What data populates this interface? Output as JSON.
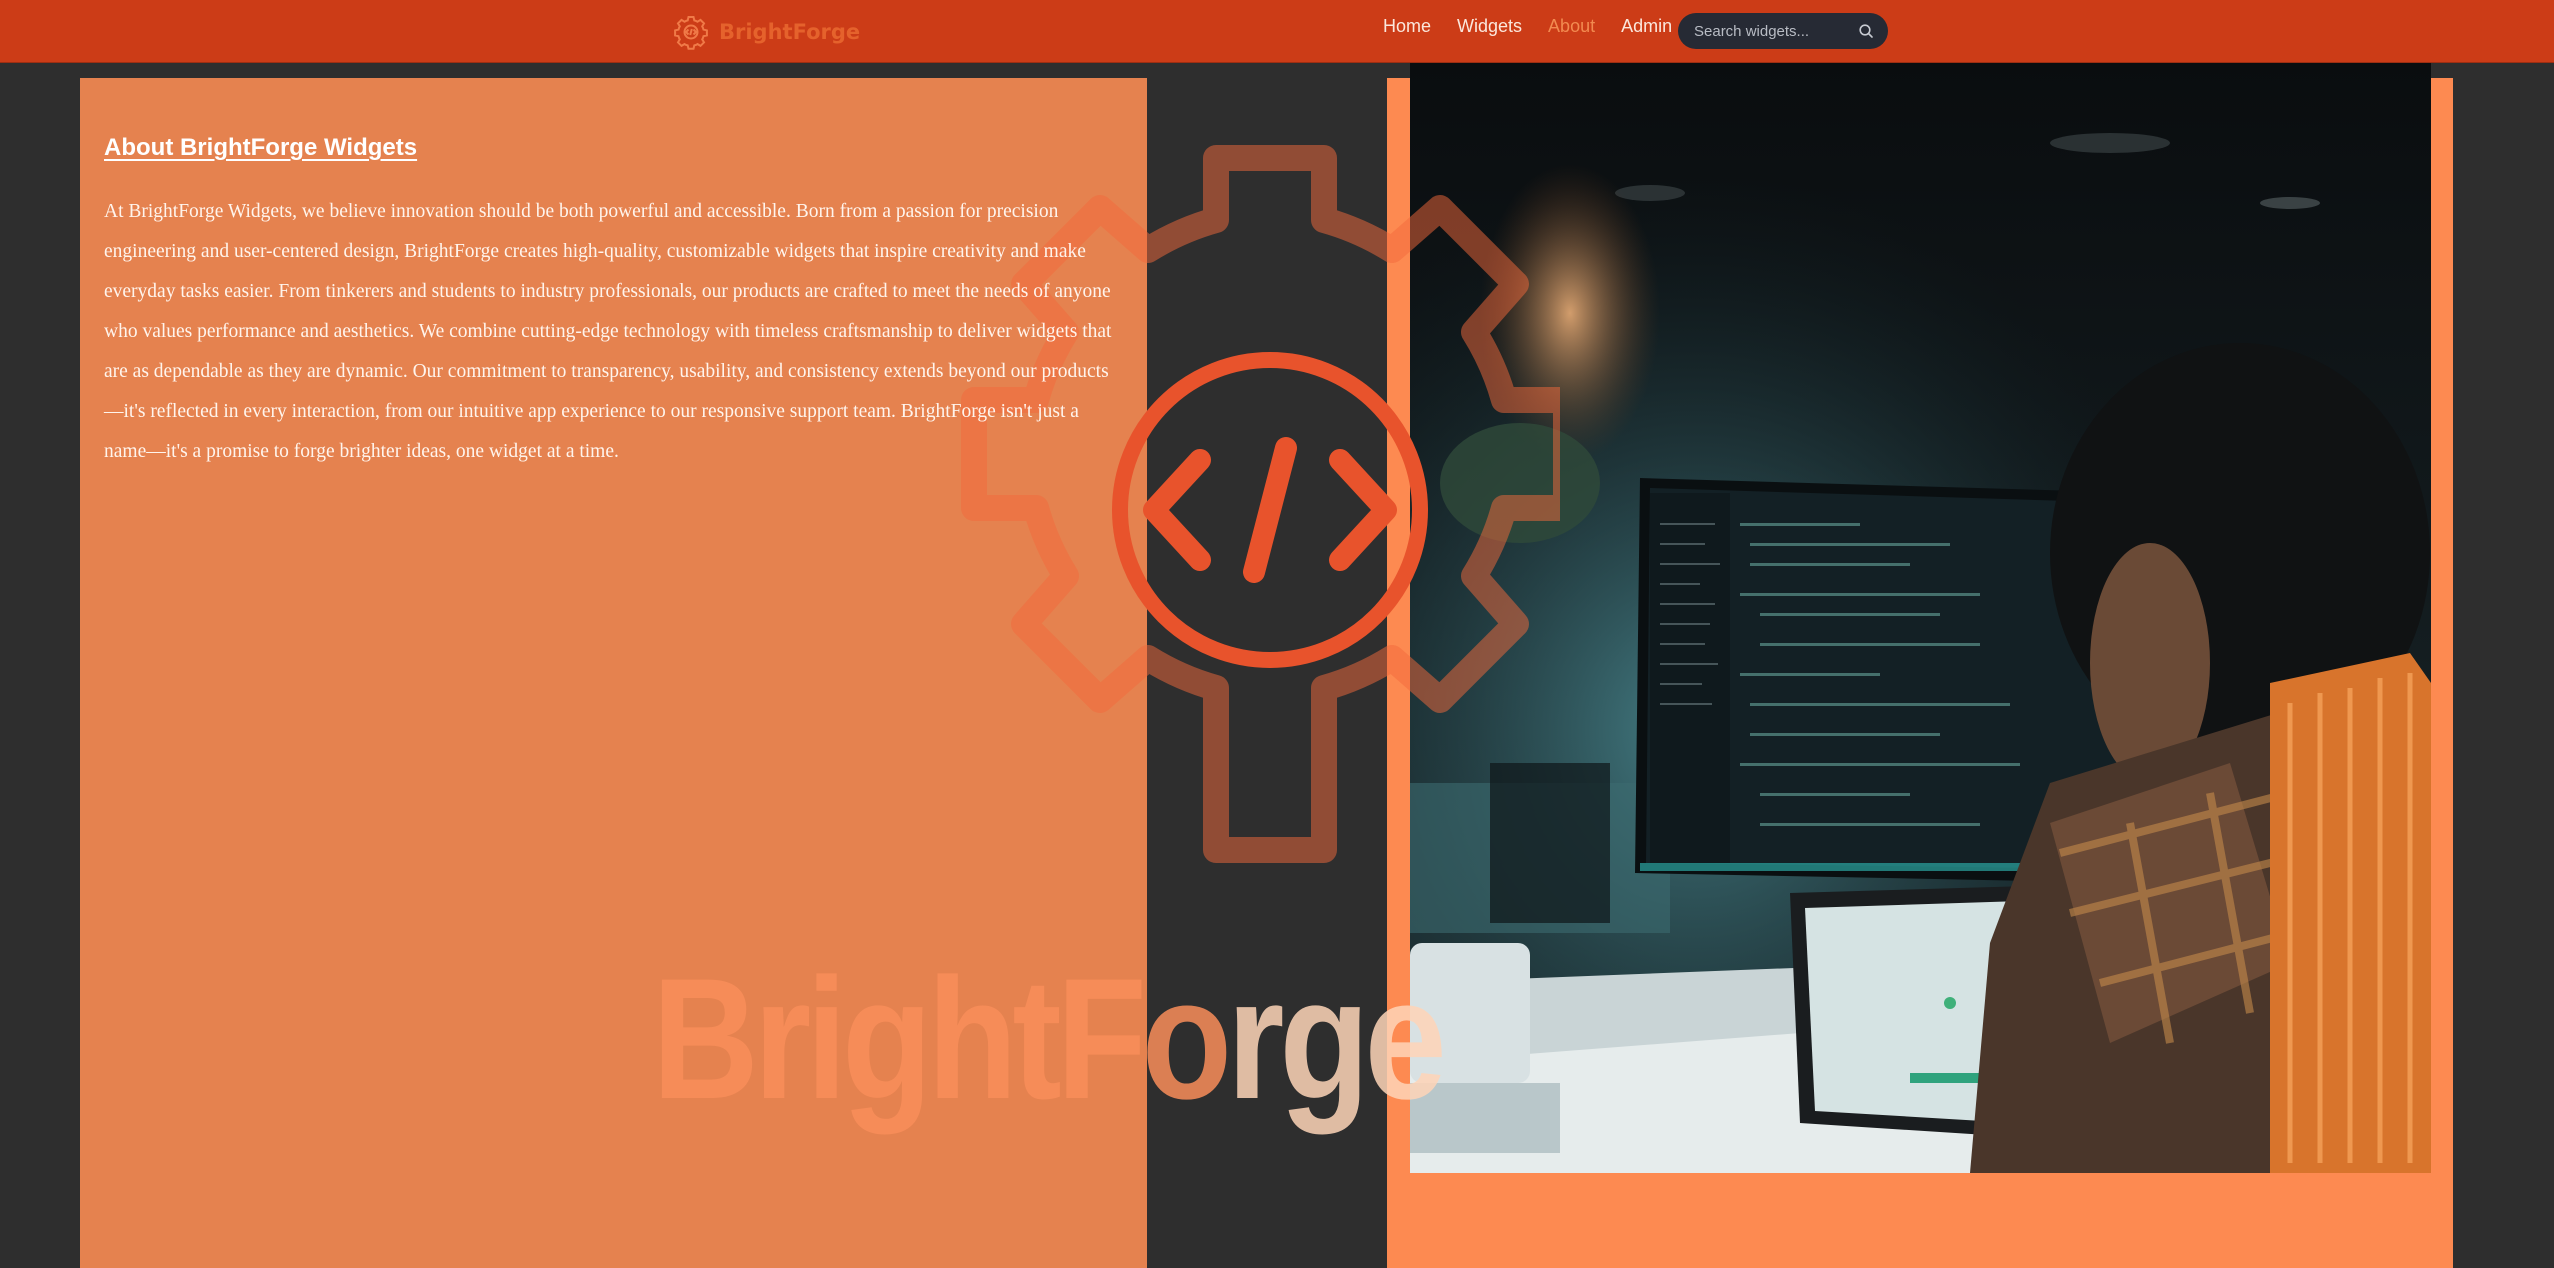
{
  "navbar": {
    "brand_name": "BrightForge",
    "brand_icon": "gear-code-icon",
    "links": [
      {
        "label": "Home",
        "active": false
      },
      {
        "label": "Widgets",
        "active": false
      },
      {
        "label": "About",
        "active": true
      },
      {
        "label": "Admin",
        "active": false
      }
    ],
    "search": {
      "placeholder": "Search widgets...",
      "icon": "search-icon"
    }
  },
  "about": {
    "title": "About BrightForge Widgets",
    "body": "At BrightForge Widgets, we believe innovation should be both powerful and accessible. Born from a passion for precision engineering and user-centered design, BrightForge creates high-quality, customizable widgets that inspire creativity and make everyday tasks easier. From tinkerers and students to industry professionals, our products are crafted to meet the needs of anyone who values performance and aesthetics. We combine cutting-edge technology with timeless craftsmanship to deliver widgets that are as dependable as they are dynamic. Our commitment to transparency, usability, and consistency extends beyond our products—it's reflected in every interaction, from our intuitive app experience to our responsive support team. BrightForge isn't just a name—it's a promise to forge brighter ideas, one widget at a time."
  },
  "background_logo": {
    "wordmark_start": "BrightFo",
    "wordmark_end": "rge",
    "icon": "gear-code-icon"
  },
  "photo": {
    "subject": "developer-at-workstation-image"
  },
  "colors": {
    "navbar": "#cc3c17",
    "panel_left": "#e5824f",
    "panel_right": "#fd8a51",
    "page_bg": "#2e2e2e",
    "accent": "#f26a3c",
    "active_link": "#f28a50",
    "search_bg": "#262a34"
  }
}
